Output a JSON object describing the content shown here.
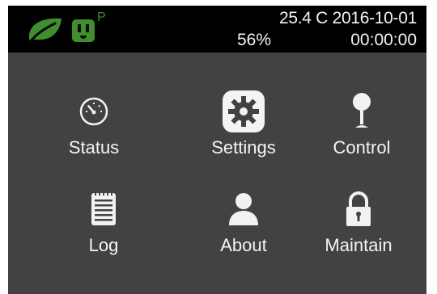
{
  "status_bar": {
    "power_indicator": "P",
    "temp_date": "25.4 C 2016-10-01",
    "humidity": "56%",
    "time": "00:00:00",
    "leaf_color": "#3f8f2e",
    "plug_color": "#3f8f2e",
    "icons": [
      "leaf-icon",
      "power-plug-icon"
    ]
  },
  "menu": {
    "items": [
      {
        "label": "Status",
        "icon": "gauge-icon"
      },
      {
        "label": "Settings",
        "icon": "gear-icon"
      },
      {
        "label": "Control",
        "icon": "joystick-icon"
      },
      {
        "label": "Log",
        "icon": "notepad-icon"
      },
      {
        "label": "About",
        "icon": "person-icon"
      },
      {
        "label": "Maintain",
        "icon": "padlock-icon"
      }
    ]
  }
}
